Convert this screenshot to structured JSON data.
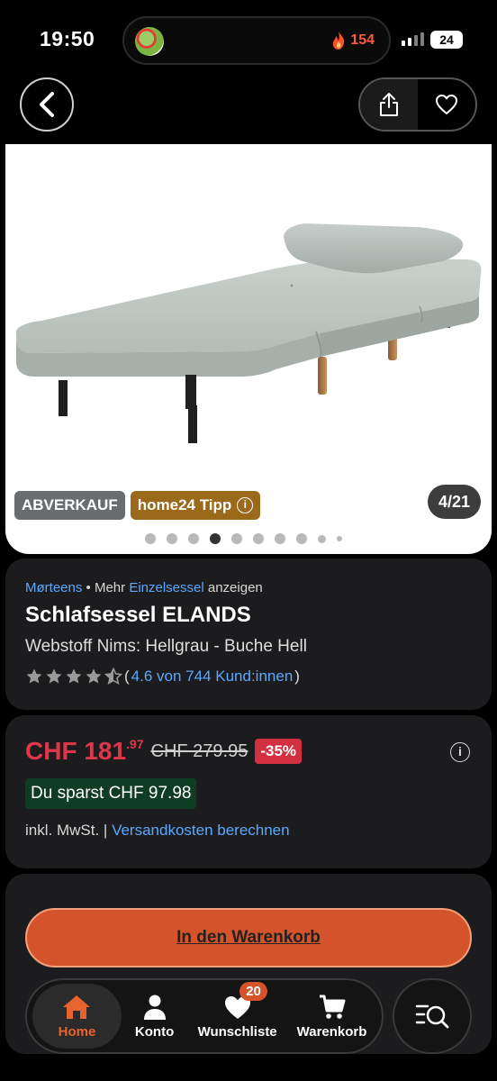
{
  "status_bar": {
    "time": "19:50",
    "streak_count": "154",
    "battery": "24"
  },
  "gallery": {
    "badge_sale": "ABVERKAUF",
    "badge_tip": "home24 Tipp",
    "badge_tip_info": "i",
    "counter": "4/21",
    "dot_count": 10,
    "active_dot": 4
  },
  "product": {
    "brand": "Mørteens",
    "crumb_separator": "•",
    "crumb_more": "Mehr",
    "category": "Einzelsessel",
    "crumb_show": "anzeigen",
    "title": "Schlafsessel ELANDS",
    "variant": "Webstoff Nims: Hellgrau - Buche Hell",
    "rating_value": 4.6,
    "rating_open": "(",
    "rating_text": "4.6 von 744 Kund:innen",
    "rating_close": ")"
  },
  "price": {
    "currency_main": "CHF 181",
    "cents": ".97",
    "old_price": "CHF 279.95",
    "discount": "-35%",
    "info": "i",
    "savings": "Du sparst CHF 97.98",
    "tax_note": "inkl. MwSt. |",
    "shipping_link": "Versandkosten berechnen"
  },
  "cart_button": "In den Warenkorb",
  "tabbar": {
    "home": "Home",
    "account": "Konto",
    "wishlist": "Wunschliste",
    "wishlist_count": "20",
    "cart": "Warenkorb"
  },
  "colors": {
    "accent": "#d4532a",
    "price_red": "#e0364a",
    "link_blue": "#5aa8ff",
    "savings_green": "#0f3d24"
  }
}
